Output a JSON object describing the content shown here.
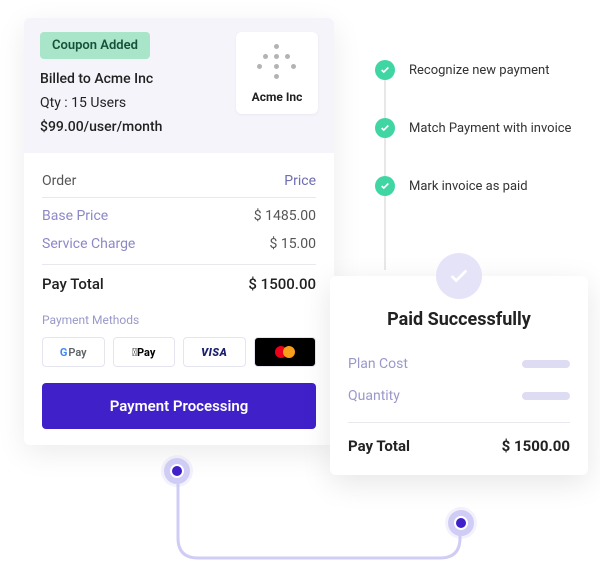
{
  "order": {
    "coupon_badge": "Coupon Added",
    "billed_to": "Billed to Acme Inc",
    "qty_line": "Qty : 15 Users",
    "unit_price": "$99.00/user/month",
    "logo_label": "Acme Inc",
    "columns": {
      "left": "Order",
      "right": "Price"
    },
    "items": [
      {
        "label": "Base Price",
        "value": "$ 1485.00"
      },
      {
        "label": "Service Charge",
        "value": "$ 15.00"
      }
    ],
    "total_label": "Pay Total",
    "total_value": "$ 1500.00",
    "payment_methods_label": "Payment Methods",
    "payment_methods": {
      "gpay": "Pay",
      "apay": "Pay",
      "visa": "VISA",
      "mastercard": "mastercard"
    },
    "process_button": "Payment Processing"
  },
  "timeline": {
    "steps": [
      "Recognize new payment",
      "Match Payment with invoice",
      "Mark invoice as paid"
    ]
  },
  "success": {
    "title": "Paid Successfully",
    "rows": [
      {
        "label": "Plan Cost"
      },
      {
        "label": "Quantity"
      }
    ],
    "total_label": "Pay Total",
    "total_value": "$ 1500.00"
  }
}
